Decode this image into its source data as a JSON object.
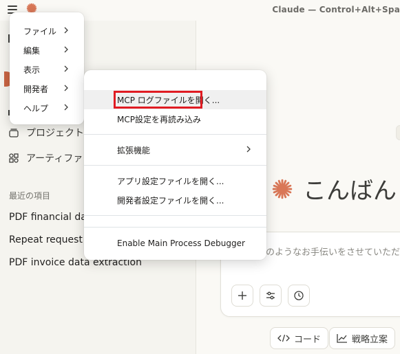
{
  "window": {
    "title": "Claude — Control+Alt+Spa"
  },
  "menu": {
    "items": [
      {
        "label": "ファイル"
      },
      {
        "label": "編集"
      },
      {
        "label": "表示"
      },
      {
        "label": "開発者"
      },
      {
        "label": "ヘルプ"
      }
    ]
  },
  "developer_submenu": {
    "items": [
      {
        "label": "MCP ログファイルを開く..."
      },
      {
        "label": "MCP設定を再読み込み"
      },
      {
        "label": "拡張機能"
      },
      {
        "label": "アプリ設定ファイルを開く..."
      },
      {
        "label": "開発者設定ファイルを開く..."
      },
      {
        "label": "Enable Main Process Debugger"
      }
    ]
  },
  "sidebar": {
    "nav": [
      {
        "label": "プロジェクト",
        "icon": "project-icon"
      },
      {
        "label": "アーティファクト",
        "icon": "artifacts-icon"
      }
    ],
    "recent_label": "最近の項目",
    "recent": [
      {
        "title": "PDF financial dat"
      },
      {
        "title": "Repeat request"
      },
      {
        "title": "PDF invoice data extraction"
      }
    ]
  },
  "main": {
    "greeting": "こんばん",
    "input_placeholder": "どのようなお手伝いをさせていただ",
    "chips": [
      {
        "label": "コード"
      },
      {
        "label": "戦略立案"
      }
    ]
  },
  "colors": {
    "accent": "#d97757",
    "highlight": "#e01b22"
  }
}
